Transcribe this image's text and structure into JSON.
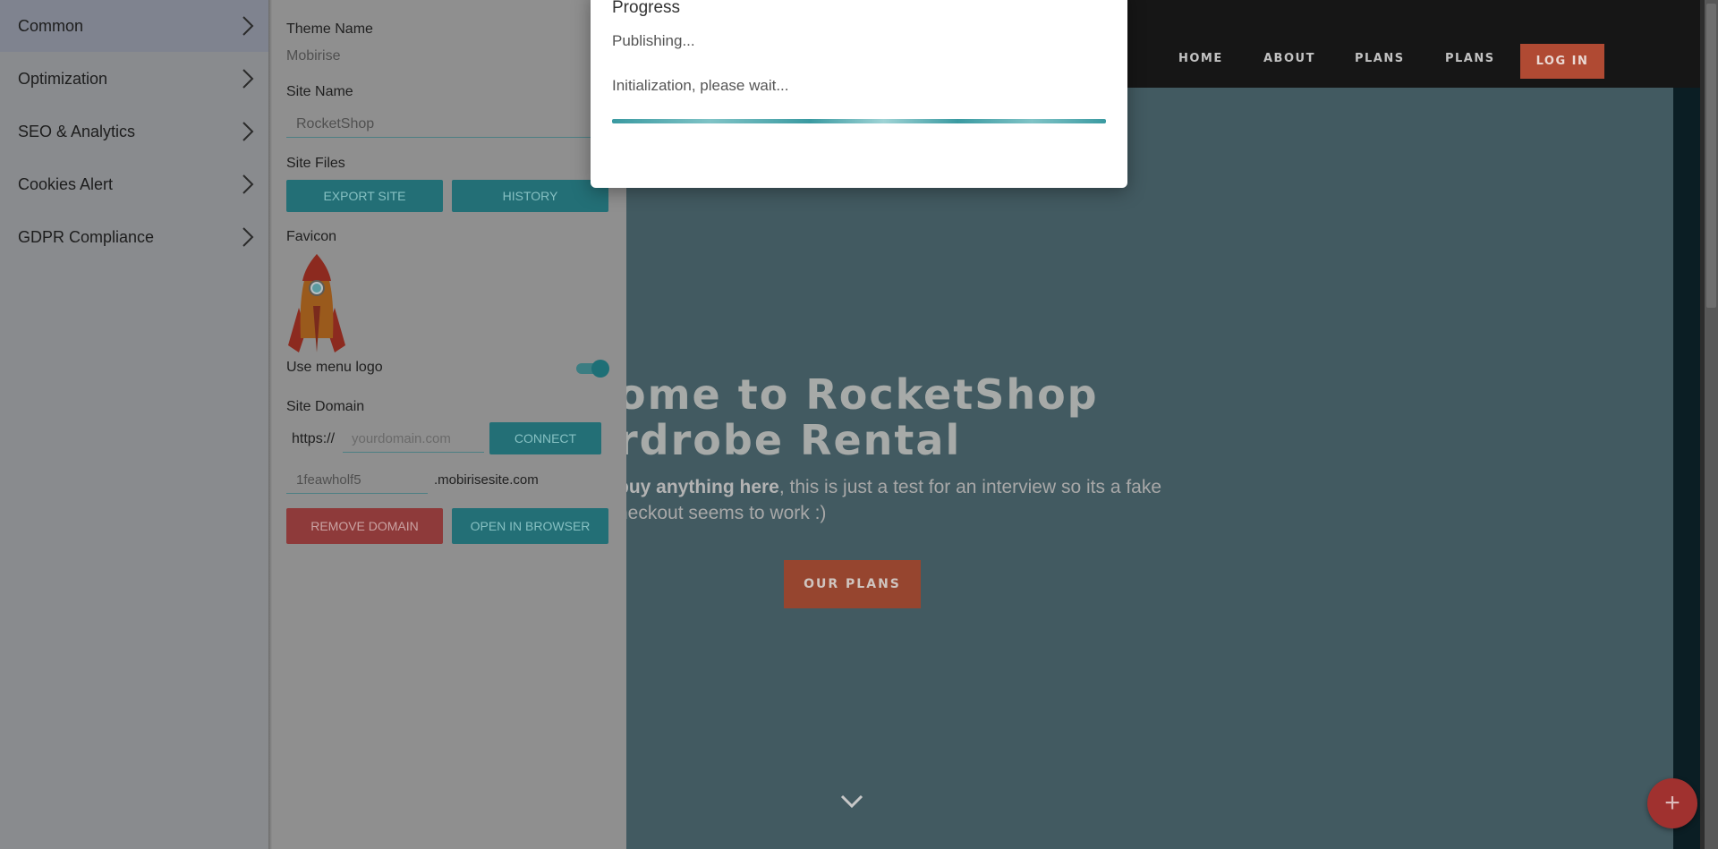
{
  "sidebar": {
    "items": [
      {
        "label": "Common",
        "active": true
      },
      {
        "label": "Optimization",
        "active": false
      },
      {
        "label": "SEO & Analytics",
        "active": false
      },
      {
        "label": "Cookies Alert",
        "active": false
      },
      {
        "label": "GDPR Compliance",
        "active": false
      }
    ]
  },
  "settings": {
    "theme_name_label": "Theme Name",
    "theme_name_value": "Mobirise",
    "site_name_label": "Site Name",
    "site_name_value": "RocketShop",
    "site_files_label": "Site Files",
    "export_button": "EXPORT SITE",
    "history_button": "HISTORY",
    "favicon_label": "Favicon",
    "use_menu_logo_label": "Use menu logo",
    "use_menu_logo_enabled": true,
    "site_domain_label": "Site Domain",
    "https_prefix": "https://",
    "domain_placeholder": "yourdomain.com",
    "connect_button": "CONNECT",
    "subdomain_value": "1feawholf5",
    "subdomain_suffix": ".mobirisesite.com",
    "remove_domain_button": "REMOVE DOMAIN",
    "open_browser_button": "OPEN IN BROWSER"
  },
  "modal": {
    "title": "Progress",
    "status": "Publishing...",
    "message": "Initialization, please wait..."
  },
  "site": {
    "nav": [
      "HOME",
      "ABOUT",
      "PLANS",
      "PLANS"
    ],
    "login": "LOG IN",
    "hero_title_line1": "ome to RocketShop",
    "hero_title_line2": "rdrobe Rental",
    "hero_text_bold": "buy anything here",
    "hero_text_rest": ", this is just a test for an interview so its a fake",
    "hero_text_line2": "heckout seems to work :)",
    "cta": "OUR PLANS"
  },
  "colors": {
    "accent_teal": "#236f76",
    "danger_red": "#8e3a3a",
    "site_orange": "#b04a33",
    "hero_bg": "#425a61"
  },
  "icons": {
    "menu_chevron": "chevron-right-icon",
    "favicon": "rocket-icon",
    "scroll": "chevron-down-icon",
    "add": "plus-icon"
  }
}
